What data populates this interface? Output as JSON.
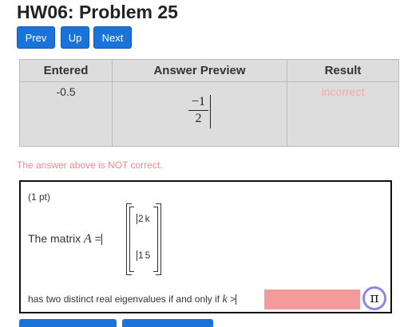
{
  "page": {
    "title": "HW06: Problem 25"
  },
  "nav": {
    "prev_label": "Prev",
    "up_label": "Up",
    "next_label": "Next"
  },
  "answer_table": {
    "headers": [
      "Entered",
      "Answer Preview",
      "Result"
    ],
    "row": {
      "entered": "-0.5",
      "preview_numerator": "−1",
      "preview_denominator": "2",
      "result": "incorrect"
    }
  },
  "warning": "The answer above is NOT correct.",
  "problem": {
    "points": "(1 pt)",
    "matrix_prefix": "The matrix",
    "matrix_var": "A",
    "matrix_eq": "=",
    "matrix_cells": [
      "2k",
      "15"
    ],
    "eigen_text": "has two distinct real eigenvalues if and only if",
    "k_var": "k",
    "gt": ">",
    "answer_value": "",
    "pi_label": "π"
  },
  "colors": {
    "button_blue": "#1a73d9",
    "incorrect_text": "#f4a9a9",
    "warning_text": "#f08a8a",
    "input_incorrect_bg": "#f59a9a",
    "pi_ring": "#8a8ae0"
  }
}
